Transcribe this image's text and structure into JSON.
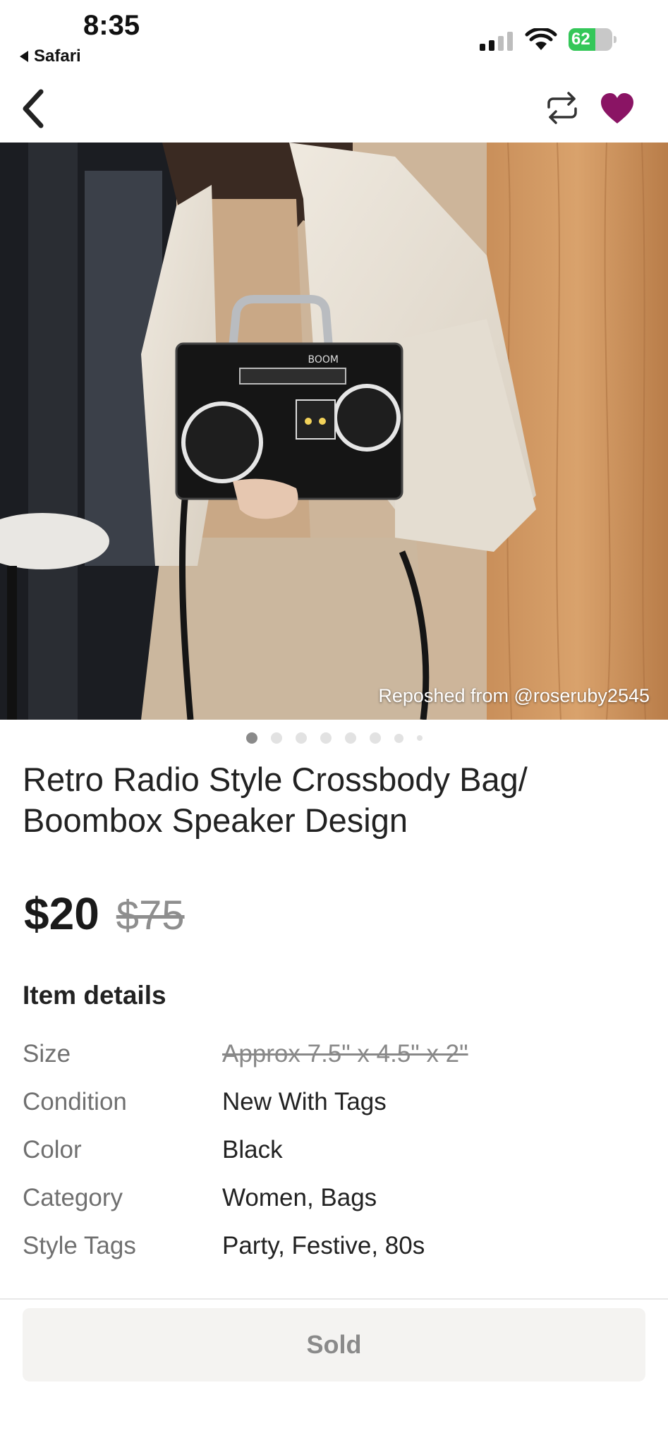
{
  "status_bar": {
    "time": "8:35",
    "back_app_label": "Safari",
    "battery_percent": "62",
    "battery_level": 0.62,
    "battery_color": "#34c759",
    "signal_bars_active": 2,
    "signal_bars_total": 4
  },
  "nav": {
    "back_icon": "chevron-left-icon",
    "share_icon": "repost-arrows-icon",
    "like_icon": "heart-icon",
    "like_color": "#8a1464"
  },
  "photo": {
    "repost_credit": "Reposhed from @roseruby2545",
    "bag_text": "BOOM"
  },
  "carousel": {
    "total_dots": 8,
    "active_index": 0
  },
  "listing": {
    "title": "Retro Radio Style Crossbody Bag/ Boombox Speaker Design",
    "price": "$20",
    "original_price": "$75"
  },
  "details": {
    "heading": "Item details",
    "rows": [
      {
        "label": "Size",
        "value": "Approx 7.5\" x 4.5\" x 2\""
      },
      {
        "label": "Condition",
        "value": "New With Tags"
      },
      {
        "label": "Color",
        "value": "Black"
      },
      {
        "label": "Category",
        "value": "Women, Bags"
      },
      {
        "label": "Style Tags",
        "value": "Party, Festive, 80s"
      }
    ]
  },
  "action": {
    "sold_label": "Sold"
  }
}
